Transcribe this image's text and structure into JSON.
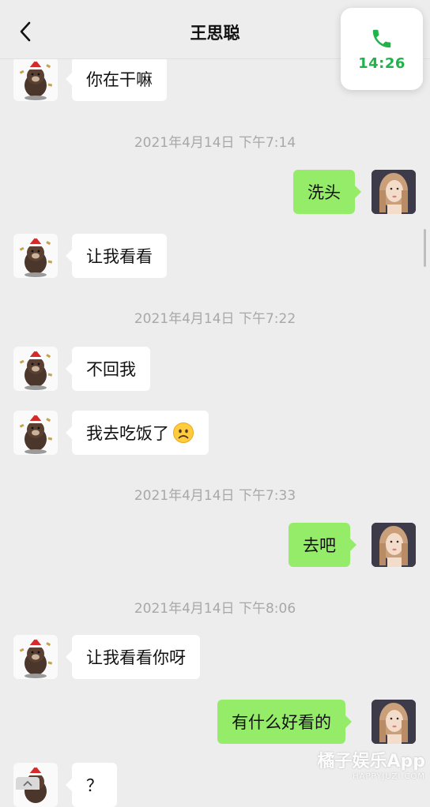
{
  "header": {
    "title": "王思聪"
  },
  "call": {
    "time": "14:26"
  },
  "timestamps": [
    "2021年4月14日 下午7:14",
    "2021年4月14日 下午7:22",
    "2021年4月14日 下午7:33",
    "2021年4月14日 下午8:06"
  ],
  "messages": [
    {
      "side": "left",
      "text": "你在干嘛"
    },
    {
      "side": "right",
      "text": "洗头"
    },
    {
      "side": "left",
      "text": "让我看看"
    },
    {
      "side": "left",
      "text": "不回我"
    },
    {
      "side": "left",
      "text": "我去吃饭了"
    },
    {
      "side": "right",
      "text": "去吧"
    },
    {
      "side": "left",
      "text": "让我看看你呀"
    },
    {
      "side": "right",
      "text": "有什么好看的"
    },
    {
      "side": "left",
      "text": "？"
    }
  ],
  "watermark": {
    "main": "橘子娱乐App",
    "sub": "HAPPYJUZI.COM"
  },
  "colors": {
    "background": "#ededed",
    "sent_bubble": "#95ec69",
    "received_bubble": "#ffffff",
    "call_green": "#22b24c"
  }
}
